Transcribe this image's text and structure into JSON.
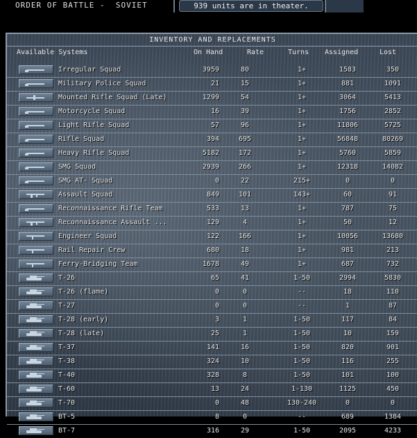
{
  "header": {
    "title": "ORDER OF BATTLE -  SOVIET",
    "status": "939 units are in theater."
  },
  "panel": {
    "title": "INVENTORY AND REPLACEMENTS",
    "columns": {
      "system": "Available Systems",
      "on_hand": "On Hand",
      "rate": "Rate",
      "turns": "Turns",
      "assigned": "Assigned",
      "lost": "Lost"
    }
  },
  "rows": [
    {
      "icon": "infantry-icon",
      "name": "Irregular Squad",
      "on_hand": "3959",
      "rate": "80",
      "turns": "1+",
      "assigned": "1583",
      "lost": "350"
    },
    {
      "icon": "infantry-icon",
      "name": "Military Police Squad",
      "on_hand": "21",
      "rate": "15",
      "turns": "1+",
      "assigned": "881",
      "lost": "1091"
    },
    {
      "icon": "mounted-infantry-icon",
      "name": "Mounted Rifle Squad (Late)",
      "on_hand": "1299",
      "rate": "54",
      "turns": "1+",
      "assigned": "3064",
      "lost": "5413"
    },
    {
      "icon": "infantry-icon",
      "name": "Motorcycle Squad",
      "on_hand": "16",
      "rate": "39",
      "turns": "1+",
      "assigned": "1756",
      "lost": "2852"
    },
    {
      "icon": "infantry-icon",
      "name": "Light Rifle Squad",
      "on_hand": "57",
      "rate": "96",
      "turns": "1+",
      "assigned": "11806",
      "lost": "5725"
    },
    {
      "icon": "infantry-icon",
      "name": "Rifle Squad",
      "on_hand": "394",
      "rate": "695",
      "turns": "1+",
      "assigned": "56848",
      "lost": "80269"
    },
    {
      "icon": "infantry-icon",
      "name": "Heavy Rifle Squad",
      "on_hand": "5182",
      "rate": "172",
      "turns": "1+",
      "assigned": "5760",
      "lost": "5859"
    },
    {
      "icon": "infantry-icon",
      "name": "SMG Squad",
      "on_hand": "2939",
      "rate": "266",
      "turns": "1+",
      "assigned": "12318",
      "lost": "14082"
    },
    {
      "icon": "infantry-icon",
      "name": "SMG AT- Squad",
      "on_hand": "0",
      "rate": "22",
      "turns": "215+",
      "assigned": "0",
      "lost": "0"
    },
    {
      "icon": "assault-infantry-icon",
      "name": "Assault Squad",
      "on_hand": "849",
      "rate": "101",
      "turns": "143+",
      "assigned": "60",
      "lost": "91"
    },
    {
      "icon": "infantry-icon",
      "name": "Reconnaissance Rifle Team",
      "on_hand": "533",
      "rate": "13",
      "turns": "1+",
      "assigned": "787",
      "lost": "75"
    },
    {
      "icon": "assault-infantry-icon",
      "name": "Reconnaissance Assault ...",
      "on_hand": "129",
      "rate": "4",
      "turns": "1+",
      "assigned": "50",
      "lost": "12"
    },
    {
      "icon": "engineer-icon",
      "name": "Engineer Squad",
      "on_hand": "122",
      "rate": "166",
      "turns": "1+",
      "assigned": "10056",
      "lost": "13680"
    },
    {
      "icon": "engineer-icon",
      "name": "Rail Repair Crew",
      "on_hand": "680",
      "rate": "18",
      "turns": "1+",
      "assigned": "981",
      "lost": "213"
    },
    {
      "icon": "engineer-icon",
      "name": "Ferry-Bridging Team",
      "on_hand": "1678",
      "rate": "49",
      "turns": "1+",
      "assigned": "687",
      "lost": "732"
    },
    {
      "icon": "tank-icon",
      "name": "T-26",
      "on_hand": "65",
      "rate": "41",
      "turns": "1-50",
      "assigned": "2994",
      "lost": "5830"
    },
    {
      "icon": "tank-icon",
      "name": "T-26 (flame)",
      "on_hand": "0",
      "rate": "0",
      "turns": "--",
      "assigned": "18",
      "lost": "110"
    },
    {
      "icon": "tank-icon",
      "name": "T-27",
      "on_hand": "0",
      "rate": "0",
      "turns": "--",
      "assigned": "1",
      "lost": "87"
    },
    {
      "icon": "tank-icon",
      "name": "T-28 (early)",
      "on_hand": "3",
      "rate": "1",
      "turns": "1-50",
      "assigned": "117",
      "lost": "84"
    },
    {
      "icon": "tank-icon",
      "name": "T-28 (late)",
      "on_hand": "25",
      "rate": "1",
      "turns": "1-50",
      "assigned": "10",
      "lost": "159"
    },
    {
      "icon": "tank-icon",
      "name": "T-37",
      "on_hand": "141",
      "rate": "16",
      "turns": "1-50",
      "assigned": "820",
      "lost": "901"
    },
    {
      "icon": "tank-icon",
      "name": "T-38",
      "on_hand": "324",
      "rate": "10",
      "turns": "1-50",
      "assigned": "116",
      "lost": "255"
    },
    {
      "icon": "tank-icon",
      "name": "T-40",
      "on_hand": "328",
      "rate": "8",
      "turns": "1-50",
      "assigned": "101",
      "lost": "100"
    },
    {
      "icon": "tank-icon",
      "name": "T-60",
      "on_hand": "13",
      "rate": "24",
      "turns": "1-130",
      "assigned": "1125",
      "lost": "450"
    },
    {
      "icon": "tank-icon",
      "name": "T-70",
      "on_hand": "0",
      "rate": "48",
      "turns": "130-240",
      "assigned": "0",
      "lost": "0"
    },
    {
      "icon": "tank-icon",
      "name": "BT-5",
      "on_hand": "8",
      "rate": "0",
      "turns": "--",
      "assigned": "689",
      "lost": "1384"
    },
    {
      "icon": "tank-icon",
      "name": "BT-7",
      "on_hand": "316",
      "rate": "29",
      "turns": "1-50",
      "assigned": "2095",
      "lost": "4233"
    }
  ]
}
